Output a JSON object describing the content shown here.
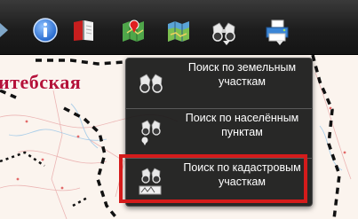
{
  "toolbar": {
    "buttons": [
      {
        "id": "info",
        "icon": "info-icon"
      },
      {
        "id": "book",
        "icon": "book-icon"
      },
      {
        "id": "map-legend",
        "icon": "map-marker-icon"
      },
      {
        "id": "map-layers",
        "icon": "map-icon"
      },
      {
        "id": "search",
        "icon": "binoculars-icon",
        "has_dropdown": true
      },
      {
        "id": "print",
        "icon": "printer-icon",
        "has_dropdown": true
      }
    ]
  },
  "map": {
    "region_label": "итебская"
  },
  "search_menu": {
    "items": [
      {
        "label": "Поиск по земельным участкам",
        "icon": "binoculars-icon"
      },
      {
        "label": "Поиск по населённым пунктам",
        "icon": "binoculars-pin-icon"
      },
      {
        "label": "Поиск по кадастровым участкам",
        "icon": "binoculars-parcel-icon",
        "highlighted": true
      }
    ]
  },
  "colors": {
    "toolbar_bg": "#1d1d1d",
    "menu_bg": "#181818",
    "highlight": "#d41b1b",
    "region_label": "#b5123a",
    "border_dash": "#111111"
  }
}
